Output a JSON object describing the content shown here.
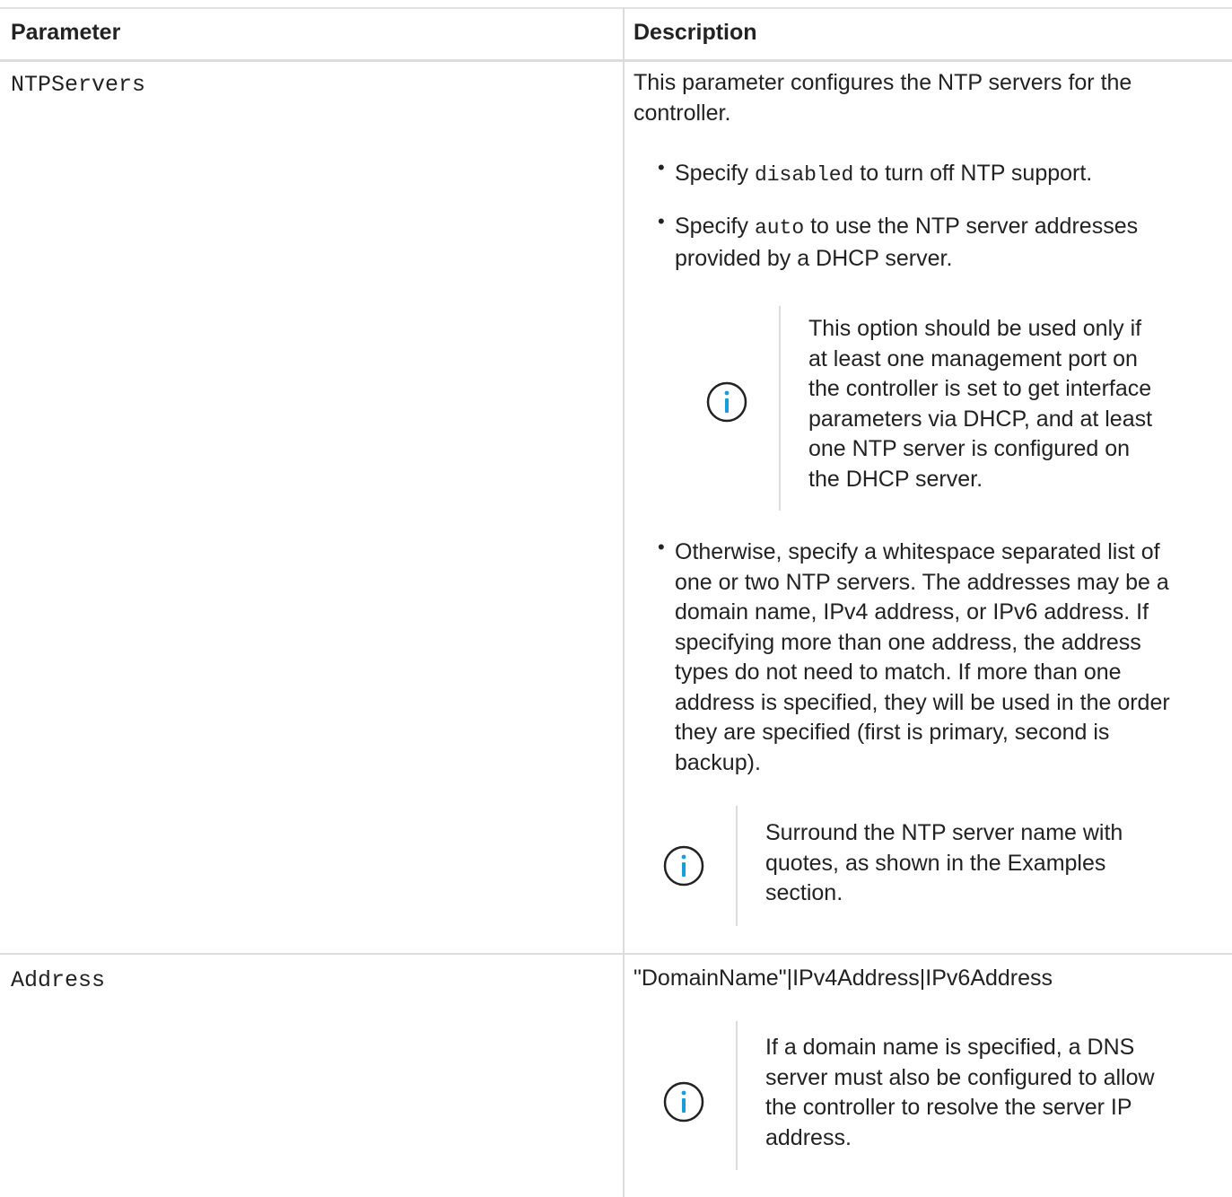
{
  "table": {
    "headers": [
      "Parameter",
      "Description"
    ],
    "rows": [
      {
        "parameter": "NTPServers",
        "desc_intro_line1": "This parameter configures the NTP servers for the",
        "desc_intro_line2": "controller.",
        "bullet1_pre": "Specify ",
        "bullet1_code": "disabled",
        "bullet1_post": " to turn off NTP support.",
        "bullet2_pre": "Specify ",
        "bullet2_code": "auto",
        "bullet2_post": " to use the NTP server addresses",
        "bullet2_line2": "provided by a DHCP server.",
        "note1_lines": [
          "This option should be used only if",
          "at least one management port on",
          "the controller is set to get interface",
          "parameters via DHCP, and at least",
          "one NTP server is configured on",
          "the DHCP server."
        ],
        "bullet3_lines": [
          "Otherwise, specify a whitespace separated list of",
          "one or two NTP servers. The addresses may be a",
          "domain name, IPv4 address, or IPv6 address. If",
          "specifying more than one address, the address",
          "types do not need to match. If more than one",
          "address is specified, they will be used in the order",
          "they are specified (first is primary, second is",
          "backup)."
        ],
        "note2_lines": [
          "Surround the NTP server name with",
          "quotes, as shown in the Examples",
          "section."
        ]
      },
      {
        "parameter": "Address",
        "desc_line": "\"DomainName\"|IPv4Address|IPv6Address",
        "note3_lines": [
          "If a domain name is specified, a DNS",
          "server must also be configured to allow",
          "the controller to resolve the server IP",
          "address."
        ]
      }
    ]
  },
  "icons": {
    "note": "info-circle-icon",
    "color": "#1a9cd8"
  }
}
